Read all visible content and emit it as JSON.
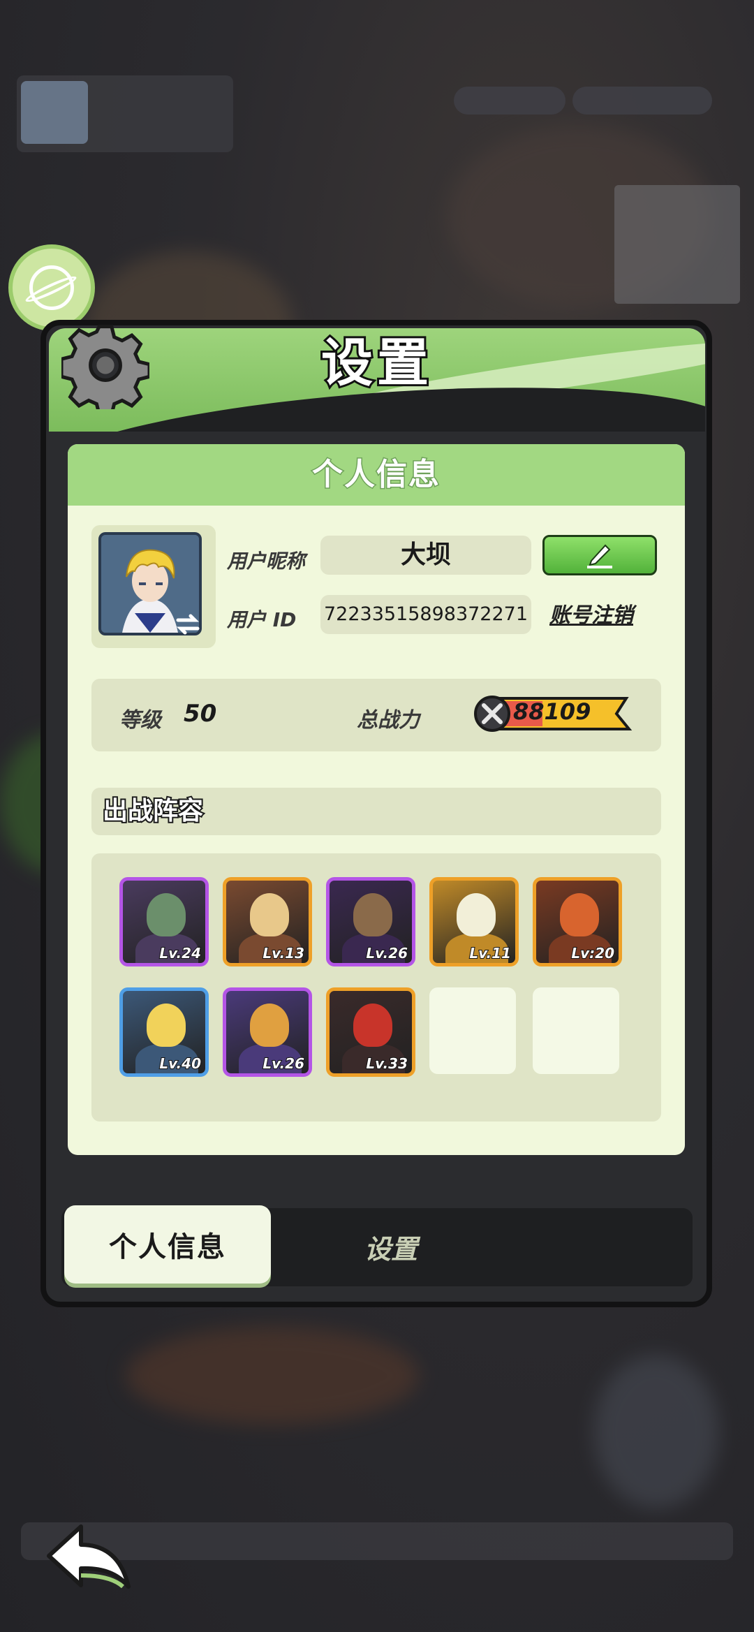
{
  "panel": {
    "title": "设置",
    "section_title": "个人信息"
  },
  "profile": {
    "nickname_label": "用户昵称",
    "nickname": "大坝",
    "id_label": "用户 ID",
    "id_value": "72233515898372271",
    "delete_account_label": "账号注销"
  },
  "stats": {
    "level_label": "等级",
    "level_value": "50",
    "power_label": "总战力",
    "power_value": "88109"
  },
  "lineup": {
    "title": "出战阵容",
    "heroes": [
      {
        "level": "Lv.24",
        "rarity": "purple",
        "colors": [
          "#4a3b5e",
          "#6b8f6b"
        ]
      },
      {
        "level": "Lv.13",
        "rarity": "orange",
        "colors": [
          "#7a4a30",
          "#e8c88a"
        ]
      },
      {
        "level": "Lv.26",
        "rarity": "purple",
        "colors": [
          "#3a2850",
          "#8a6a4a"
        ]
      },
      {
        "level": "Lv.11",
        "rarity": "orange",
        "colors": [
          "#c08a28",
          "#f2efd8"
        ]
      },
      {
        "level": "Lv:20",
        "rarity": "orange",
        "colors": [
          "#7a3a22",
          "#d8642e"
        ]
      },
      {
        "level": "Lv.40",
        "rarity": "blue",
        "colors": [
          "#3c5878",
          "#f1d25a"
        ]
      },
      {
        "level": "Lv.26",
        "rarity": "purple",
        "colors": [
          "#4a3a7a",
          "#e0a040"
        ]
      },
      {
        "level": "Lv.33",
        "rarity": "orange",
        "colors": [
          "#3a2a2a",
          "#c8342a"
        ]
      }
    ],
    "empty_slots": 2
  },
  "tabs": {
    "active": "个人信息",
    "inactive": "设置"
  },
  "colors": {
    "header_green": "#8cc86c",
    "card_bg": "#f1f8dc",
    "edit_green": "#6cc84a",
    "power_yellow": "#f5c02a"
  }
}
